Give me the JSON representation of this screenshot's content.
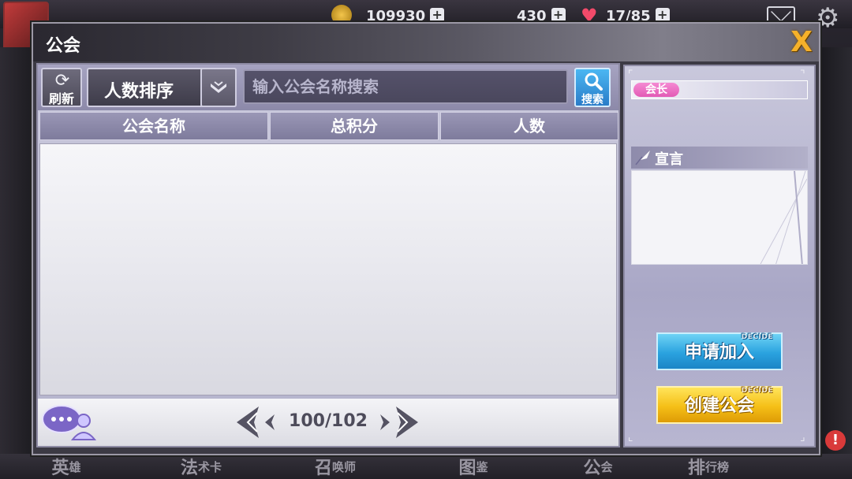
{
  "topbar": {
    "gold": "109930",
    "gems": "430",
    "stamina": "17/85",
    "plus_label": "+"
  },
  "modal": {
    "title": "公会",
    "close_label": "X"
  },
  "toolbar": {
    "refresh_label": "刷新",
    "sort_label": "人数排序",
    "search_placeholder": "输入公会名称搜索",
    "search_button_label": "搜索"
  },
  "table": {
    "columns": [
      "公会名称",
      "总积分",
      "人数"
    ],
    "rows": []
  },
  "pagination": {
    "page_text": "100/102"
  },
  "detail": {
    "leader_label": "会长",
    "declaration_title": "宣言",
    "declaration_text": "",
    "apply_label": "申请加入",
    "create_label": "创建公会",
    "button_tag": "DECIDE"
  },
  "bottom_nav": [
    {
      "big": "英",
      "small": "雄"
    },
    {
      "big": "法",
      "small": "术卡"
    },
    {
      "big": "召",
      "small": "唤师"
    },
    {
      "big": "图",
      "small": "鉴"
    },
    {
      "big": "公",
      "small": "会"
    },
    {
      "big": "排",
      "small": "行榜"
    }
  ],
  "badge_count": "!"
}
